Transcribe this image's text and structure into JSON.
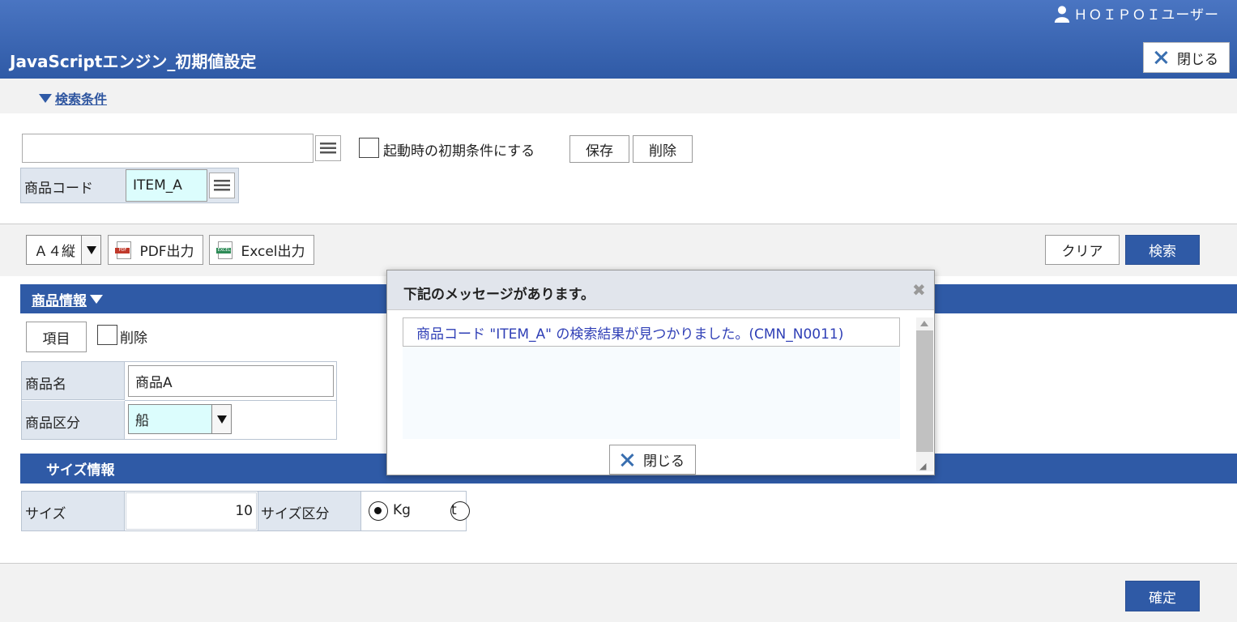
{
  "header": {
    "user_name": "ＨＯＩＰＯＩユーザー",
    "title": "JavaScriptエンジン_初期値設定",
    "close_label": "閉じる"
  },
  "search_condition": {
    "toggle_label": "検索条件",
    "condition_input_value": "",
    "startup_checkbox_label": "起動時の初期条件にする",
    "save_label": "保存",
    "delete_label": "削除",
    "product_code_label": "商品コード",
    "product_code_value": "ITEM_A"
  },
  "action_bar": {
    "paper_size": "Ａ４縦",
    "pdf_label": "PDF出力",
    "excel_label": "Excel出力",
    "pdf_icon_text": "PDF",
    "excel_icon_text": "EXCEL",
    "clear_label": "クリア",
    "search_label": "検索"
  },
  "product_info": {
    "section_title": "商品情報",
    "item_button_label": "項目",
    "delete_checkbox_label": "削除",
    "name_label": "商品名",
    "name_value": "商品A",
    "category_label": "商品区分",
    "category_value": "船"
  },
  "size_info": {
    "section_title": "サイズ情報",
    "size_label": "サイズ",
    "size_value": "10",
    "unit_label": "サイズ区分",
    "unit_options": [
      "Kg",
      "t"
    ],
    "unit_selected": "Kg"
  },
  "footer": {
    "confirm_label": "確定"
  },
  "modal": {
    "title": "下記のメッセージがあります。",
    "messages": [
      "商品コード \"ITEM_A\" の検索結果が見つかりました。(CMN_N0011)"
    ],
    "close_label": "閉じる"
  },
  "colors": {
    "brand_blue": "#2f5aa6",
    "label_bg": "#dfe6ef",
    "highlight_input": "#dcfdfd",
    "message_text": "#2f3fb6"
  }
}
